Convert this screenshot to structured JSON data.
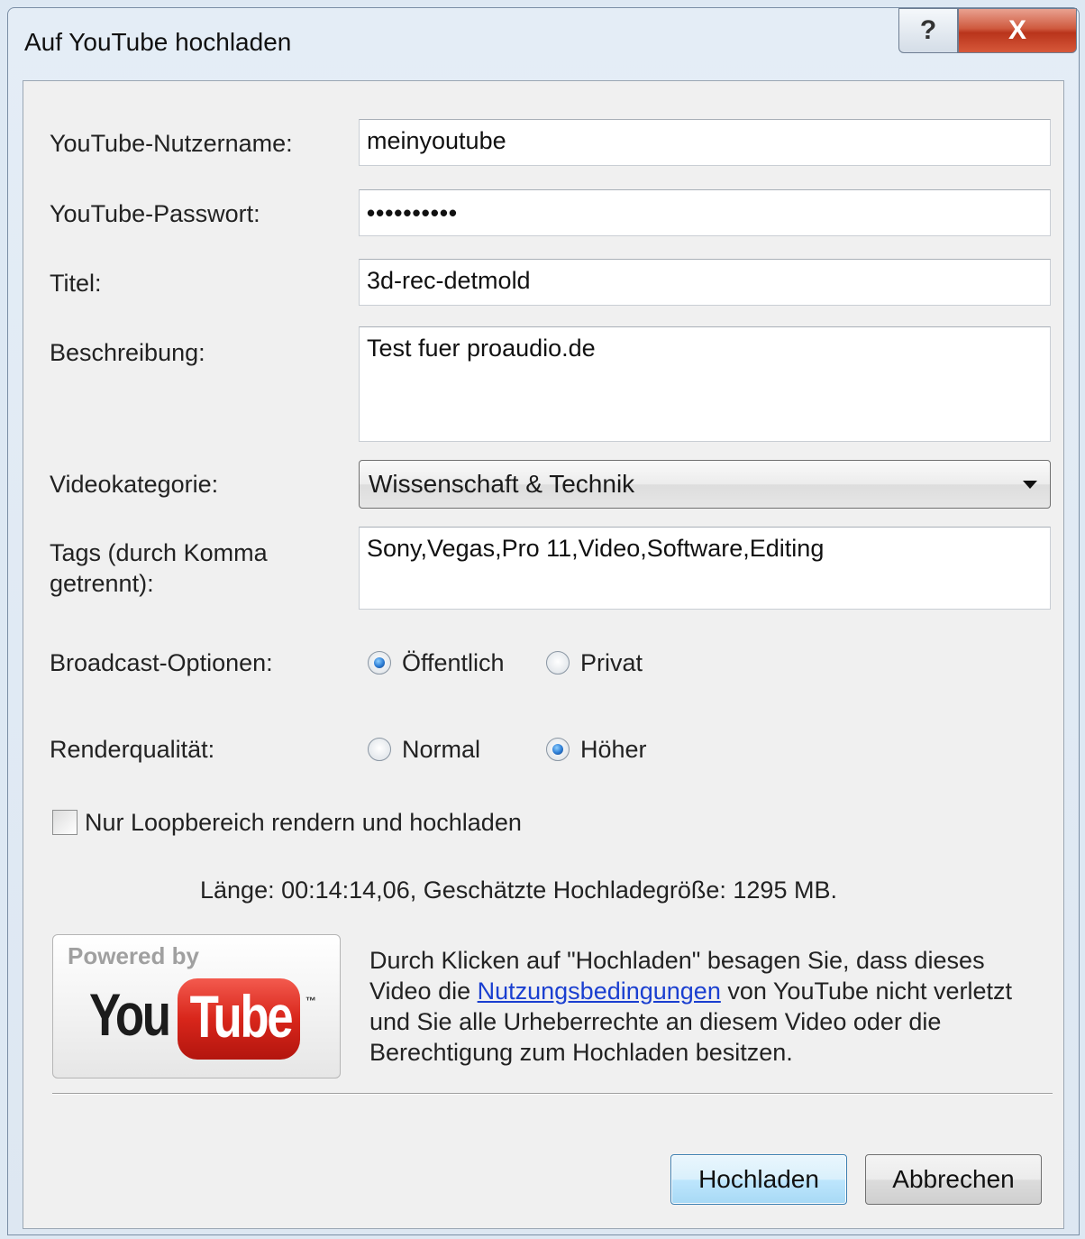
{
  "window": {
    "title": "Auf YouTube hochladen",
    "help_glyph": "?",
    "close_glyph": "X"
  },
  "form": {
    "username_label": "YouTube-Nutzername:",
    "username_value": "meinyoutube",
    "password_label": "YouTube-Passwort:",
    "password_value": "••••••••••",
    "title_label": "Titel:",
    "title_value": "3d-rec-detmold",
    "description_label": "Beschreibung:",
    "description_value": "Test fuer proaudio.de",
    "category_label": "Videokategorie:",
    "category_value": "Wissenschaft & Technik",
    "tags_label_line1": "Tags (durch Komma",
    "tags_label_line2": "getrennt):",
    "tags_value": "Sony,Vegas,Pro 11,Video,Software,Editing",
    "broadcast_label": "Broadcast-Optionen:",
    "broadcast_options": [
      {
        "label": "Öffentlich",
        "selected": true
      },
      {
        "label": "Privat",
        "selected": false
      }
    ],
    "quality_label": "Renderqualität:",
    "quality_options": [
      {
        "label": "Normal",
        "selected": false
      },
      {
        "label": "Höher",
        "selected": true
      }
    ],
    "loop_checkbox_label": "Nur Loopbereich rendern und hochladen",
    "loop_checked": false
  },
  "info": {
    "length_line": "Länge: 00:14:14,06,  Geschätzte Hochladegröße: 1295 MB."
  },
  "youtube_logo": {
    "powered_by": "Powered by",
    "you": "You",
    "tube": "Tube",
    "tm": "™"
  },
  "notice": {
    "text_before_link": "Durch Klicken auf \"Hochladen\" besagen Sie, dass dieses Video die ",
    "link": "Nutzungsbedingungen",
    "text_after_link": " von YouTube nicht verletzt und Sie alle Urheberrechte an diesem Video oder die Berechtigung zum Hochladen besitzen."
  },
  "buttons": {
    "upload": "Hochladen",
    "cancel": "Abbrechen"
  },
  "colors": {
    "link": "#1a3fd0",
    "close_button": "#c8412a",
    "youtube_red": "#d8261b"
  }
}
